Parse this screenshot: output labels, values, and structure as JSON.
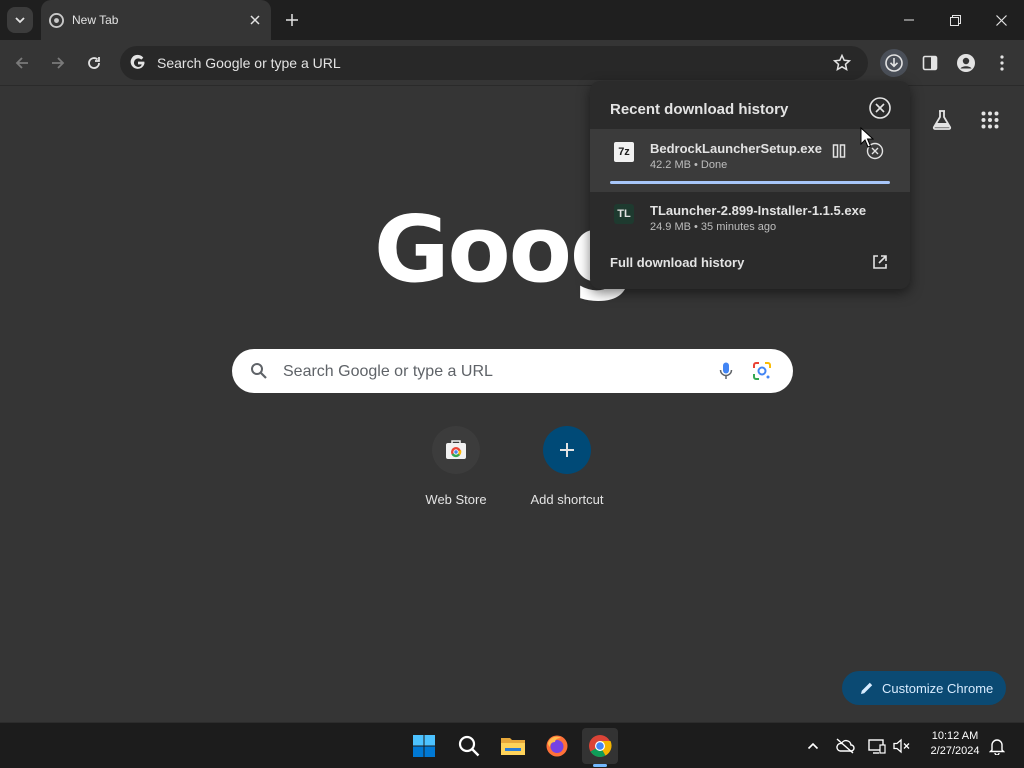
{
  "browser": {
    "tab_title": "New Tab",
    "omnibox_placeholder": "Search Google or type a URL"
  },
  "newtab": {
    "logo_text": "Goog",
    "search_placeholder": "Search Google or type a URL",
    "shortcuts": [
      {
        "label": "Web Store"
      },
      {
        "label": "Add shortcut"
      }
    ],
    "customize_label": "Customize Chrome"
  },
  "downloads_panel": {
    "header": "Recent download history",
    "items": [
      {
        "icon_text": "7z",
        "name": "BedrockLauncherSetup.exe",
        "meta": "42.2 MB • Done"
      },
      {
        "icon_text": "TL",
        "name": "TLauncher-2.899-Installer-1.1.5.exe",
        "meta": "24.9 MB • 35 minutes ago"
      }
    ],
    "full_history_label": "Full download history"
  },
  "taskbar": {
    "time": "10:12 AM",
    "date": "2/27/2024"
  },
  "colors": {
    "accent": "#a8c7fa",
    "customize_bg": "#0b4a73",
    "panel_bg": "#2b2b2b"
  }
}
